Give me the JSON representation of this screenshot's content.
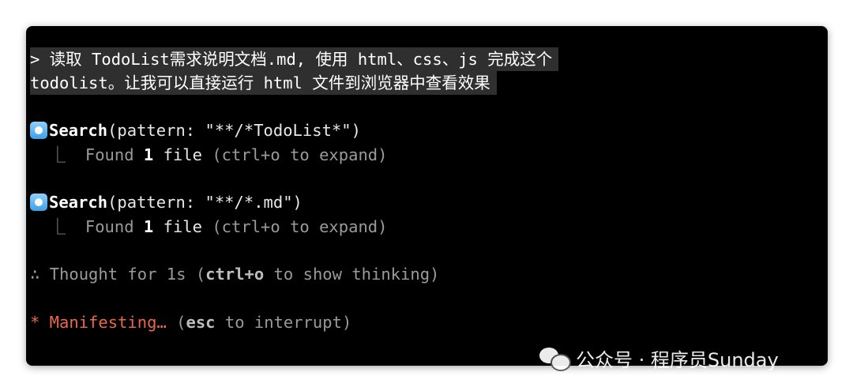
{
  "prompt": {
    "line1": "> 读取 TodoList需求说明文档.md, 使用 html、css、js 完成这个",
    "line2": "todolist。让我可以直接运行 html 文件到浏览器中查看效果"
  },
  "actions": [
    {
      "tool": "Search",
      "args": "(pattern: \"**/*TodoList*\")",
      "result_prefix": "  ⎿  Found ",
      "result_count": "1",
      "result_suffix": " file",
      "hint": " (ctrl+o to expand)"
    },
    {
      "tool": "Search",
      "args": "(pattern: \"**/*.md\")",
      "result_prefix": "  ⎿  Found ",
      "result_count": "1",
      "result_suffix": " file",
      "hint": " (ctrl+o to expand)"
    }
  ],
  "thought": {
    "prefix": "∴ Thought for 1s (",
    "key": "ctrl+o",
    "suffix": " to show thinking)"
  },
  "status": {
    "spinner": "* Manifesting…",
    "open": " (",
    "key": "esc",
    "suffix": " to interrupt)"
  },
  "watermark": {
    "text": "公众号 · 程序员Sunday"
  },
  "colors": {
    "background": "#000000",
    "status": "#e8684a",
    "bullet": "#3ba0e8"
  }
}
